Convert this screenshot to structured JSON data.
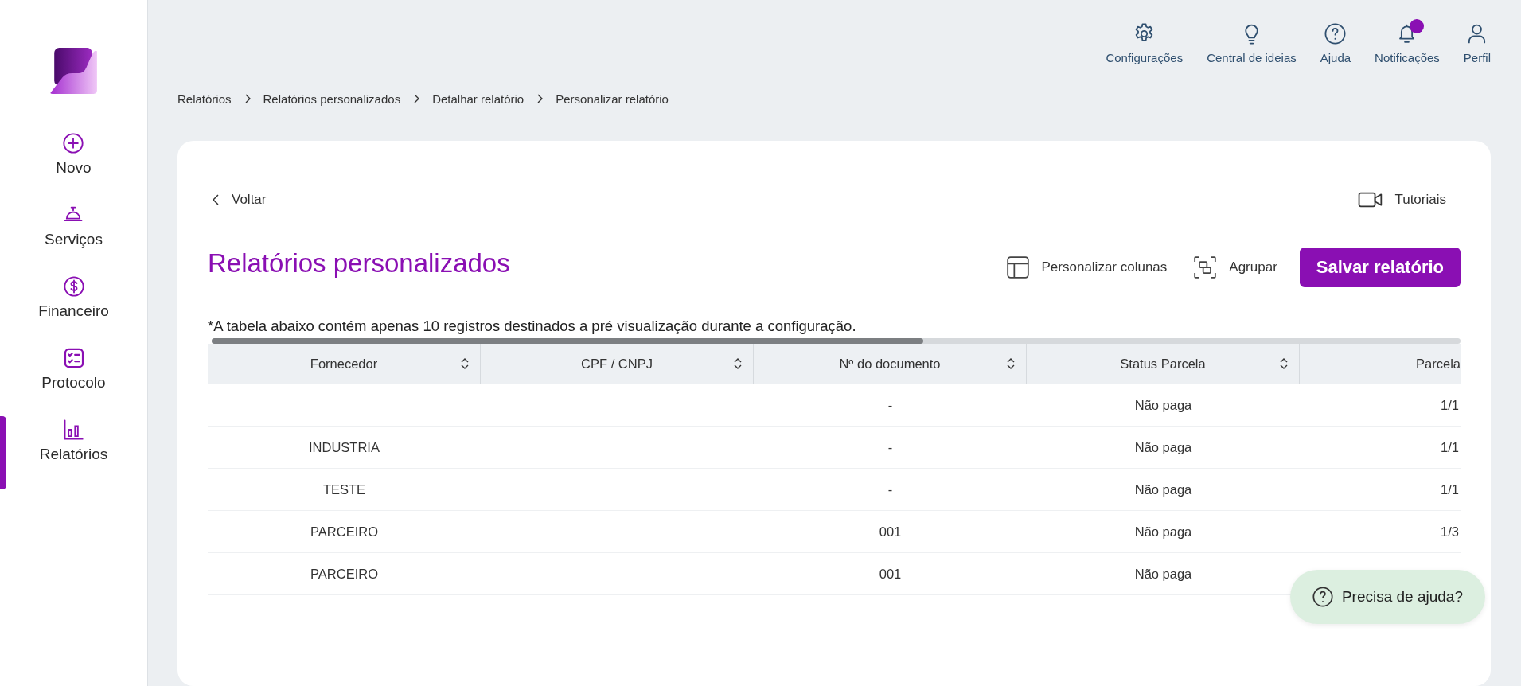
{
  "sidebar": {
    "items": [
      {
        "label": "Novo",
        "selected": false
      },
      {
        "label": "Serviços",
        "selected": false
      },
      {
        "label": "Financeiro",
        "selected": false
      },
      {
        "label": "Protocolo",
        "selected": false
      },
      {
        "label": "Relatórios",
        "selected": true
      }
    ]
  },
  "top_actions": [
    {
      "label": "Configurações",
      "badge": false
    },
    {
      "label": "Central de ideias",
      "badge": false
    },
    {
      "label": "Ajuda",
      "badge": false
    },
    {
      "label": "Notificações",
      "badge": true
    },
    {
      "label": "Perfil",
      "badge": false
    }
  ],
  "breadcrumb": [
    "Relatórios",
    "Relatórios personalizados",
    "Detalhar relatório",
    "Personalizar relatório"
  ],
  "back_link": "Voltar",
  "tutorials": "Tutoriais",
  "title": "Relatórios personalizados",
  "toolbar": {
    "customize_columns": "Personalizar colunas",
    "group": "Agrupar",
    "save": "Salvar relatório"
  },
  "note": "*A tabela abaixo contém apenas 10 registros destinados a pré visualização durante a configuração.",
  "table": {
    "columns": [
      "Fornecedor",
      "CPF / CNPJ",
      "Nº do documento",
      "Status Parcela",
      "Parcela"
    ],
    "rows": [
      {
        "fornecedor": ".",
        "documento": "-",
        "status": "Não paga",
        "parcela": "1/1"
      },
      {
        "fornecedor": "INDUSTRIA",
        "documento": "-",
        "status": "Não paga",
        "parcela": "1/1"
      },
      {
        "fornecedor": "TESTE",
        "documento": "-",
        "status": "Não paga",
        "parcela": "1/1"
      },
      {
        "fornecedor": "PARCEIRO",
        "documento": "001",
        "status": "Não paga",
        "parcela": "1/3"
      },
      {
        "fornecedor": "PARCEIRO",
        "documento": "001",
        "status": "Não paga"
      }
    ]
  },
  "help_button": "Precisa de ajuda?"
}
